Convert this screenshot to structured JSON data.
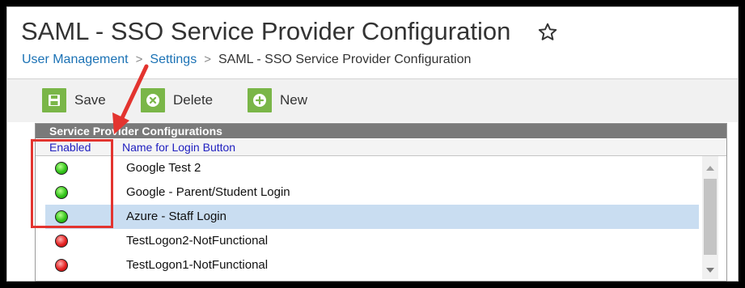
{
  "header": {
    "title": "SAML - SSO Service Provider Configuration",
    "breadcrumb": [
      "User Management",
      "Settings",
      "SAML - SSO Service Provider Configuration"
    ]
  },
  "toolbar": {
    "save_label": "Save",
    "delete_label": "Delete",
    "new_label": "New"
  },
  "grid": {
    "title": "Service Provider Configurations",
    "columns": [
      "Enabled",
      "Name for Login Button"
    ],
    "rows": [
      {
        "enabled": "green",
        "name": "Google Test 2",
        "selected": false
      },
      {
        "enabled": "green",
        "name": "Google - Parent/Student Login",
        "selected": false
      },
      {
        "enabled": "green",
        "name": "Azure - Staff Login",
        "selected": true
      },
      {
        "enabled": "red",
        "name": "TestLogon2-NotFunctional",
        "selected": false
      },
      {
        "enabled": "red",
        "name": "TestLogon1-NotFunctional",
        "selected": false
      }
    ]
  },
  "colors": {
    "accent_green": "#7ab648",
    "link_blue": "#1b72b5",
    "selected_row": "#c9ddf1",
    "annotation_red": "#e3342f"
  },
  "icons": [
    "star-icon",
    "save-icon",
    "delete-icon",
    "new-icon",
    "status-green-icon",
    "status-red-icon"
  ]
}
